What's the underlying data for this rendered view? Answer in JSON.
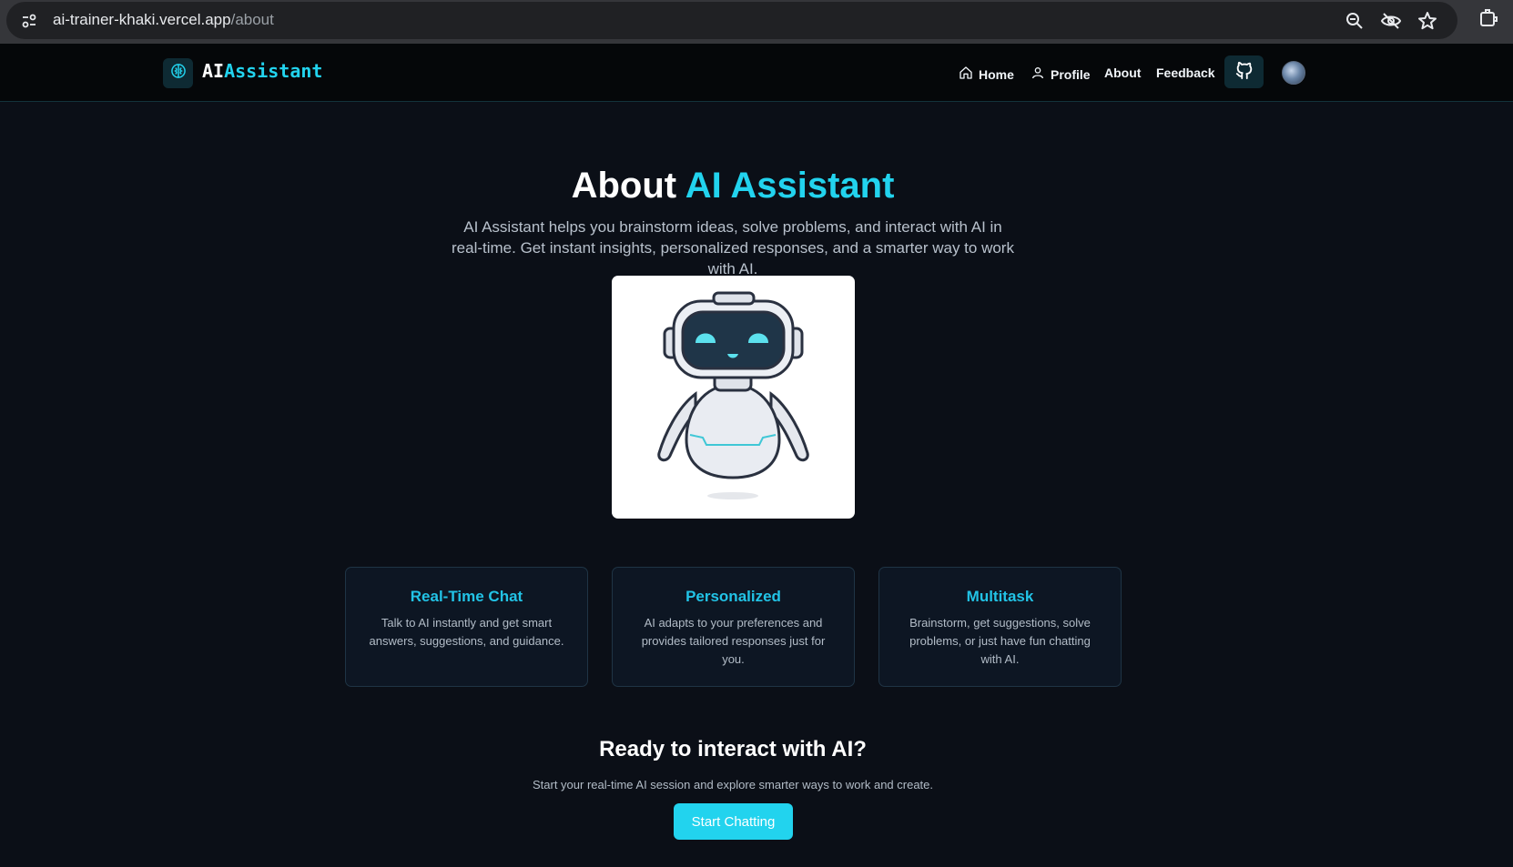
{
  "browser": {
    "url_host": "ai-trainer-khaki.vercel.app",
    "url_path": "/about"
  },
  "header": {
    "logo_prefix": "AI",
    "logo_suffix": "Assistant",
    "nav": {
      "home": "Home",
      "profile": "Profile",
      "about": "About",
      "feedback": "Feedback"
    }
  },
  "hero": {
    "title_prefix": "About",
    "title_accent": "AI Assistant",
    "description": "AI Assistant helps you brainstorm ideas, solve problems, and interact with AI in real-time. Get instant insights, personalized responses, and a smarter way to work with AI."
  },
  "features": [
    {
      "title": "Real-Time Chat",
      "text": "Talk to AI instantly and get smart answers, suggestions, and guidance."
    },
    {
      "title": "Personalized",
      "text": "AI adapts to your preferences and provides tailored responses just for you."
    },
    {
      "title": "Multitask",
      "text": "Brainstorm, get suggestions, solve problems, or just have fun chatting with AI."
    }
  ],
  "cta": {
    "title": "Ready to interact with AI?",
    "subtitle": "Start your real-time AI session and explore smarter ways to work and create.",
    "button": "Start Chatting"
  },
  "colors": {
    "accent": "#22d3ee",
    "background": "#0b0f17",
    "card": "#0d1623"
  },
  "icons": [
    "site-info-icon",
    "zoom-icon",
    "eye-slash-icon",
    "star-icon",
    "extensions-icon",
    "brain-icon",
    "home-icon",
    "user-icon",
    "github-icon",
    "robot-illustration"
  ]
}
